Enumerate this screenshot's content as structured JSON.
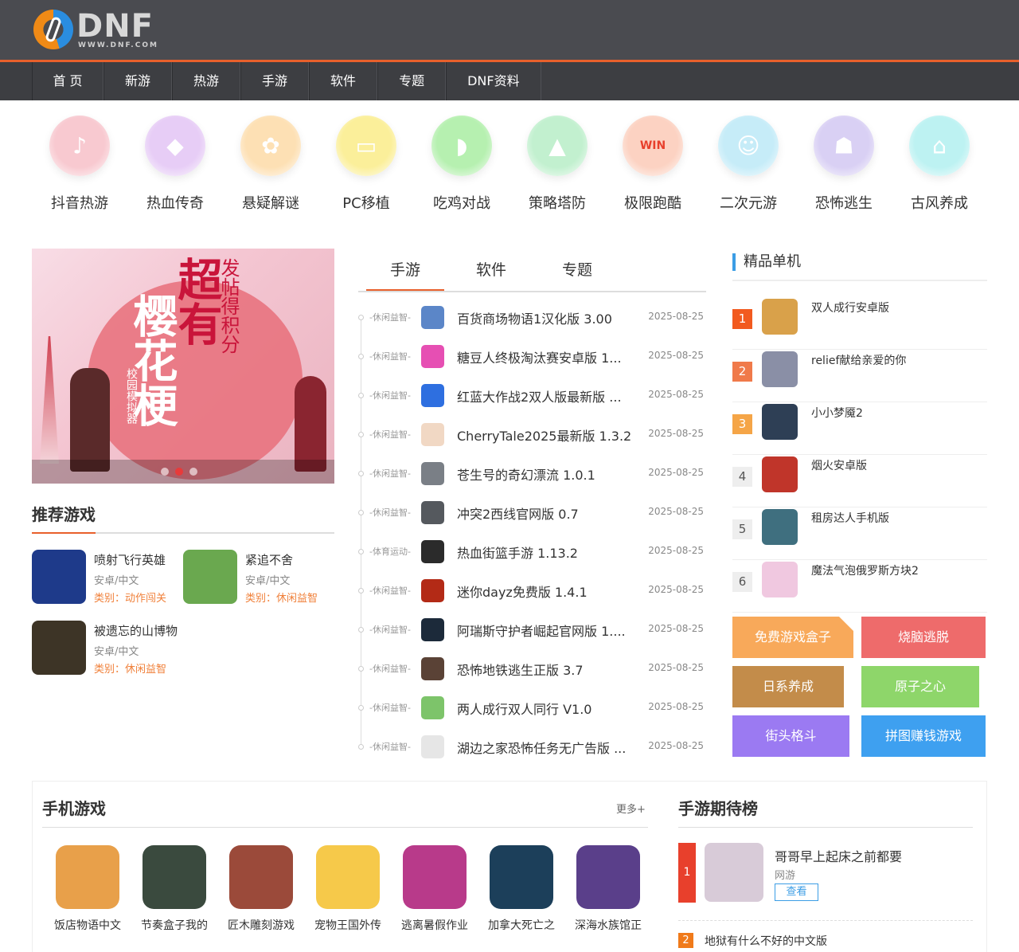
{
  "header": {
    "logo_word": "DNF",
    "logo_url": "WWW.DNF.COM",
    "nav": [
      "首 页",
      "新游",
      "热游",
      "手游",
      "软件",
      "专题",
      "DNF资料"
    ]
  },
  "categories": [
    {
      "label": "抖音热游",
      "icon": "tiktok-icon",
      "color": "#f8c9d0",
      "glyph": "♪"
    },
    {
      "label": "热血传奇",
      "icon": "crystal-icon",
      "color": "#e7cdf6",
      "glyph": "◆"
    },
    {
      "label": "悬疑解谜",
      "icon": "brain-icon",
      "color": "#fde0b4",
      "glyph": "✿"
    },
    {
      "label": "PC移植",
      "icon": "laptop-icon",
      "color": "#fbef9a",
      "glyph": "▭"
    },
    {
      "label": "吃鸡对战",
      "icon": "helmet-icon",
      "color": "#b6f0b0",
      "glyph": "◗"
    },
    {
      "label": "策略塔防",
      "icon": "tent-icon",
      "color": "#c2f0cf",
      "glyph": "▲"
    },
    {
      "label": "极限跑酷",
      "icon": "win-icon",
      "color": "#fcd2c2",
      "glyph": "WIN"
    },
    {
      "label": "二次元游",
      "icon": "robot-icon",
      "color": "#c6ecf8",
      "glyph": "☺"
    },
    {
      "label": "恐怖逃生",
      "icon": "ghost-icon",
      "color": "#d9d0f4",
      "glyph": "☗"
    },
    {
      "label": "古风养成",
      "icon": "scholar-hat-icon",
      "color": "#bdf2f2",
      "glyph": "⌂"
    }
  ],
  "banner": {
    "title_red": "超有",
    "title_white": "樱花梗",
    "side_text": "发帖得积分",
    "small_text": "校园模拟器"
  },
  "recommend": {
    "title": "推荐游戏",
    "items": [
      {
        "name": "喷射飞行英雄",
        "platform": "安卓/中文",
        "category": "类别：动作闯关",
        "color": "#1e3a8a"
      },
      {
        "name": "紧追不舍",
        "platform": "安卓/中文",
        "category": "类别：休闲益智",
        "color": "#6aa84f"
      },
      {
        "name": "被遗忘的山博物",
        "platform": "安卓/中文",
        "category": "类别：休闲益智",
        "color": "#3d3426"
      }
    ]
  },
  "tabs": [
    {
      "label": "手游",
      "active": true
    },
    {
      "label": "软件",
      "active": false
    },
    {
      "label": "专题",
      "active": false
    }
  ],
  "game_list": [
    {
      "cls": "-休闲益智-",
      "name": "百货商场物语1汉化版 3.00",
      "date": "2025-08-25",
      "color": "#5b86c8"
    },
    {
      "cls": "-休闲益智-",
      "name": "糖豆人终极淘汰赛安卓版 1...",
      "date": "2025-08-25",
      "color": "#e64fb3"
    },
    {
      "cls": "-休闲益智-",
      "name": "红蓝大作战2双人版最新版 ...",
      "date": "2025-08-25",
      "color": "#2e6fe0"
    },
    {
      "cls": "-休闲益智-",
      "name": "CherryTale2025最新版 1.3.2",
      "date": "2025-08-25",
      "color": "#f1d8c4"
    },
    {
      "cls": "-休闲益智-",
      "name": "苍生号的奇幻漂流 1.0.1",
      "date": "2025-08-25",
      "color": "#7a7f86"
    },
    {
      "cls": "-休闲益智-",
      "name": "冲突2西线官网版 0.7",
      "date": "2025-08-25",
      "color": "#55595e"
    },
    {
      "cls": "-体育运动-",
      "name": "热血街篮手游 1.13.2",
      "date": "2025-08-25",
      "color": "#2b2b2b"
    },
    {
      "cls": "-休闲益智-",
      "name": "迷你dayz免费版 1.4.1",
      "date": "2025-08-25",
      "color": "#b32a16"
    },
    {
      "cls": "-休闲益智-",
      "name": "阿瑞斯守护者崛起官网版 1....",
      "date": "2025-08-25",
      "color": "#1c2a3a"
    },
    {
      "cls": "-休闲益智-",
      "name": "恐怖地铁逃生正版 3.7",
      "date": "2025-08-25",
      "color": "#5a4236"
    },
    {
      "cls": "-休闲益智-",
      "name": "两人成行双人同行 V1.0",
      "date": "2025-08-25",
      "color": "#7dc46a"
    },
    {
      "cls": "-休闲益智-",
      "name": "湖边之家恐怖任务无广告版 ...",
      "date": "2025-08-25",
      "color": "#e6e6e6"
    }
  ],
  "ranking": {
    "title": "精品单机",
    "items": [
      {
        "no": "1",
        "name": "双人成行安卓版",
        "badge": "#f25a1f",
        "color": "#d9a14a"
      },
      {
        "no": "2",
        "name": "relief献给亲爱的你",
        "badge": "#f07a4a",
        "color": "#8a8fa6"
      },
      {
        "no": "3",
        "name": "小小梦魇2",
        "badge": "#f5a547",
        "color": "#2e3f55"
      },
      {
        "no": "4",
        "name": "烟火安卓版",
        "badge": "#eeeeee",
        "color": "#c0352a"
      },
      {
        "no": "5",
        "name": "租房达人手机版",
        "badge": "#eeeeee",
        "color": "#3f6f7f"
      },
      {
        "no": "6",
        "name": "魔法气泡俄罗斯方块2",
        "badge": "#eeeeee",
        "color": "#f0c8e0"
      }
    ]
  },
  "tags": [
    {
      "label": "免费游戏盒子",
      "color": "#f8a95a"
    },
    {
      "label": "烧脑逃脱",
      "color": "#ee6b6b"
    },
    {
      "label": "日系养成",
      "color": "#c38c4a"
    },
    {
      "label": "原子之心",
      "color": "#8ed66a"
    },
    {
      "label": "街头格斗",
      "color": "#9b7af2"
    },
    {
      "label": "拼图赚钱游戏",
      "color": "#3ea0f0"
    }
  ],
  "mobile_games": {
    "title": "手机游戏",
    "more": "更多+",
    "items": [
      {
        "name": "饭店物语中文",
        "color": "#e8a04a"
      },
      {
        "name": "节奏盒子我的",
        "color": "#3a4a3e"
      },
      {
        "name": "匠木雕刻游戏",
        "color": "#9b4a3a"
      },
      {
        "name": "宠物王国外传",
        "color": "#f6c94a"
      },
      {
        "name": "逃离暑假作业",
        "color": "#b83a8a"
      },
      {
        "name": "加拿大死亡之",
        "color": "#1c3f5a"
      },
      {
        "name": "深海水族馆正",
        "color": "#5a3f8a"
      }
    ]
  },
  "expected": {
    "title": "手游期待榜",
    "first": {
      "no": "1",
      "name": "哥哥早上起床之前都要",
      "type": "网游",
      "button": "查看",
      "color": "#d8cbd8"
    },
    "second": {
      "no": "2",
      "name": "地狱有什么不好的中文版"
    }
  }
}
